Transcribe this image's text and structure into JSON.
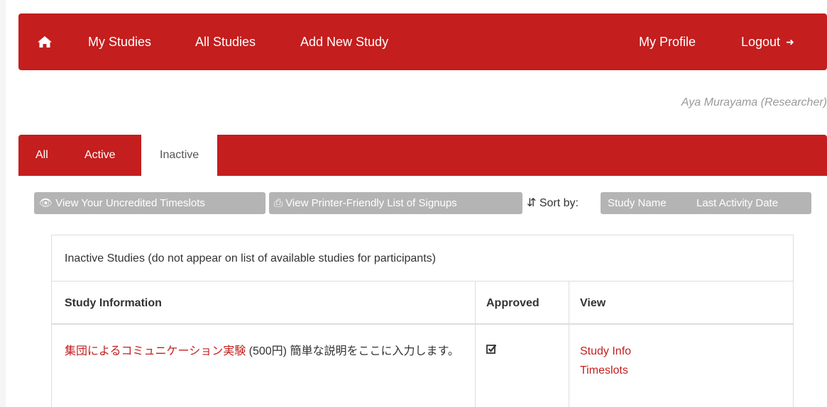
{
  "navbar": {
    "home_icon": "home-icon",
    "links": [
      "My Studies",
      "All Studies",
      "Add New Study"
    ],
    "profile": "My Profile",
    "logout": "Logout",
    "logout_icon": "logout-icon"
  },
  "user": "Aya Murayama (Researcher)",
  "tabs": [
    "All",
    "Active",
    "Inactive"
  ],
  "toolbar": {
    "view_uncredited": "View Your Uncredited Timeslots",
    "view_printer": "View Printer-Friendly List of Signups",
    "sort_label": "Sort by:",
    "sort_options": [
      "Study Name",
      "Last Activity Date"
    ]
  },
  "table": {
    "title": "Inactive Studies (do not appear on list of available studies for participants)",
    "headers": [
      "Study Information",
      "Approved",
      "View"
    ],
    "rows": [
      {
        "study_name": "集団によるコミュニケーション実験",
        "details": " (500円) 簡単な説明をここに入力します。",
        "approved_icon": "checked-square-icon",
        "links": [
          "Study Info",
          "Timeslots"
        ]
      }
    ]
  },
  "colors": {
    "brand": "#c41e1e",
    "button_gray": "#b4b4b4"
  }
}
